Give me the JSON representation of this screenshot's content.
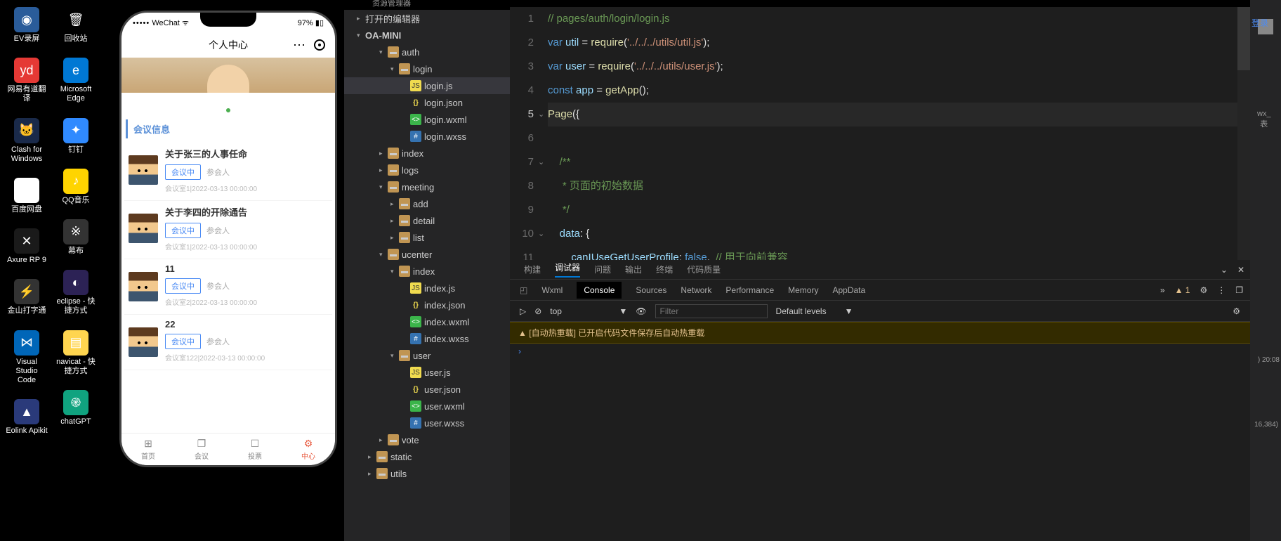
{
  "desktop": {
    "col1": [
      {
        "name": "ev-recorder",
        "label": "EV录屏",
        "bg": "#2a5c9a",
        "glyph": "◉"
      },
      {
        "name": "youdao",
        "label": "网易有道翻译",
        "bg": "#e53935",
        "glyph": "yd"
      },
      {
        "name": "clash",
        "label": "Clash for Windows",
        "bg": "#1a2a4a",
        "glyph": "🐱"
      },
      {
        "name": "baidu-pan",
        "label": "百度网盘",
        "bg": "#fff",
        "glyph": "☁"
      },
      {
        "name": "axure",
        "label": "Axure RP 9",
        "bg": "#1a1a1a",
        "glyph": "✕"
      },
      {
        "name": "jinshan",
        "label": "金山打字通",
        "bg": "#333",
        "glyph": "⚡"
      },
      {
        "name": "vscode",
        "label": "Visual Studio Code",
        "bg": "#0066b8",
        "glyph": "⋈"
      },
      {
        "name": "eolink",
        "label": "Eolink Apikit",
        "bg": "#2a3a7a",
        "glyph": "▲"
      }
    ],
    "col2": [
      {
        "name": "recycle",
        "label": "回收站",
        "bg": "transparent",
        "glyph": "🗑"
      },
      {
        "name": "edge",
        "label": "Microsoft Edge",
        "bg": "#0078d4",
        "glyph": "e"
      },
      {
        "name": "dingtalk",
        "label": "钉钉",
        "bg": "#308aff",
        "glyph": "✦"
      },
      {
        "name": "qqmusic",
        "label": "QQ音乐",
        "bg": "#ffd400",
        "glyph": "♪"
      },
      {
        "name": "mubu",
        "label": "幕布",
        "bg": "#333",
        "glyph": "※"
      },
      {
        "name": "eclipse",
        "label": "eclipse - 快捷方式",
        "bg": "#2c2255",
        "glyph": "◐"
      },
      {
        "name": "navicat",
        "label": "navicat - 快捷方式",
        "bg": "#ffd54f",
        "glyph": "▤"
      },
      {
        "name": "chatgpt",
        "label": "chatGPT",
        "bg": "#10a37f",
        "glyph": "֎"
      }
    ]
  },
  "phone": {
    "carrier": "WeChat",
    "signal": "•••••",
    "batt": "97%",
    "navTitle": "个人中心",
    "sectionTitle": "会议信息",
    "meetings": [
      {
        "title": "关于张三的人事任命",
        "badge": "会议中",
        "part": "参会人",
        "meta": "会议室1|2022-03-13 00:00:00"
      },
      {
        "title": "关于李四的开除通告",
        "badge": "会议中",
        "part": "参会人",
        "meta": "会议室1|2022-03-13 00:00:00"
      },
      {
        "title": "11",
        "badge": "会议中",
        "part": "参会人",
        "meta": "会议室2|2022-03-13 00:00:00"
      },
      {
        "title": "22",
        "badge": "会议中",
        "part": "参会人",
        "meta": "会议室122|2022-03-13 00:00:00"
      }
    ],
    "tabs": [
      {
        "label": "首页",
        "icon": "⊞"
      },
      {
        "label": "会议",
        "icon": "❐"
      },
      {
        "label": "投票",
        "icon": "☐"
      },
      {
        "label": "中心",
        "icon": "⚙"
      }
    ],
    "activeTab": 3
  },
  "ide": {
    "resourceLabel": "资源管理器",
    "tree": [
      {
        "d": 1,
        "chev": "▸",
        "ico": "",
        "label": "打开的编辑器"
      },
      {
        "d": 1,
        "chev": "▾",
        "ico": "",
        "label": "OA-MINI",
        "bold": true
      },
      {
        "d": 3,
        "chev": "▾",
        "ico": "folder",
        "label": "auth"
      },
      {
        "d": 4,
        "chev": "▾",
        "ico": "folder",
        "label": "login"
      },
      {
        "d": 5,
        "chev": "",
        "ico": "js",
        "label": "login.js",
        "sel": true
      },
      {
        "d": 5,
        "chev": "",
        "ico": "json",
        "label": "login.json"
      },
      {
        "d": 5,
        "chev": "",
        "ico": "wxml",
        "label": "login.wxml"
      },
      {
        "d": 5,
        "chev": "",
        "ico": "wxss",
        "label": "login.wxss"
      },
      {
        "d": 3,
        "chev": "▸",
        "ico": "folder",
        "label": "index"
      },
      {
        "d": 3,
        "chev": "▸",
        "ico": "folder",
        "label": "logs"
      },
      {
        "d": 3,
        "chev": "▾",
        "ico": "folder",
        "label": "meeting"
      },
      {
        "d": 4,
        "chev": "▸",
        "ico": "folder",
        "label": "add"
      },
      {
        "d": 4,
        "chev": "▸",
        "ico": "folder",
        "label": "detail"
      },
      {
        "d": 4,
        "chev": "▸",
        "ico": "folder",
        "label": "list"
      },
      {
        "d": 3,
        "chev": "▾",
        "ico": "folder",
        "label": "ucenter"
      },
      {
        "d": 4,
        "chev": "▾",
        "ico": "folder",
        "label": "index"
      },
      {
        "d": 5,
        "chev": "",
        "ico": "js",
        "label": "index.js"
      },
      {
        "d": 5,
        "chev": "",
        "ico": "json",
        "label": "index.json"
      },
      {
        "d": 5,
        "chev": "",
        "ico": "wxml",
        "label": "index.wxml"
      },
      {
        "d": 5,
        "chev": "",
        "ico": "wxss",
        "label": "index.wxss"
      },
      {
        "d": 4,
        "chev": "▾",
        "ico": "folder",
        "label": "user"
      },
      {
        "d": 5,
        "chev": "",
        "ico": "js",
        "label": "user.js"
      },
      {
        "d": 5,
        "chev": "",
        "ico": "json",
        "label": "user.json"
      },
      {
        "d": 5,
        "chev": "",
        "ico": "wxml",
        "label": "user.wxml"
      },
      {
        "d": 5,
        "chev": "",
        "ico": "wxss",
        "label": "user.wxss"
      },
      {
        "d": 3,
        "chev": "▸",
        "ico": "folder",
        "label": "vote"
      },
      {
        "d": 2,
        "chev": "▸",
        "ico": "folder",
        "label": "static",
        "yellow": true
      },
      {
        "d": 2,
        "chev": "▸",
        "ico": "folder",
        "label": "utils"
      }
    ]
  },
  "editor": {
    "lines": [
      {
        "n": 1,
        "html": "<span class='c-cmt'>// pages/auth/login/login.js</span>"
      },
      {
        "n": 2,
        "html": "<span class='c-kw'>var</span> <span class='c-var'>util</span> <span class='c-op'>=</span> <span class='c-fn'>require</span><span class='c-pun'>(</span><span class='c-str'>'../../../utils/util.js'</span><span class='c-pun'>);</span>"
      },
      {
        "n": 3,
        "html": "<span class='c-kw'>var</span> <span class='c-var'>user</span> <span class='c-op'>=</span> <span class='c-fn'>require</span><span class='c-pun'>(</span><span class='c-str'>'../../../utils/user.js'</span><span class='c-pun'>);</span>"
      },
      {
        "n": 4,
        "html": "<span class='c-kw'>const</span> <span class='c-var'>app</span> <span class='c-op'>=</span> <span class='c-fn'>getApp</span><span class='c-pun'>();</span>"
      },
      {
        "n": 5,
        "html": "<span class='c-fn'>Page</span><span class='c-pun'>({</span>",
        "cur": true
      },
      {
        "n": 6,
        "html": ""
      },
      {
        "n": 7,
        "html": "    <span class='c-doc'>/**</span>"
      },
      {
        "n": 8,
        "html": "<span class='c-doc'>     * 页面的初始数据</span>"
      },
      {
        "n": 9,
        "html": "<span class='c-doc'>     */</span>"
      },
      {
        "n": 10,
        "html": "    <span class='c-var'>data</span><span class='c-pun'>: {</span>"
      },
      {
        "n": 11,
        "html": "        <span class='c-var'>canIUseGetUserProfile</span><span class='c-pun'>:</span> <span class='c-bool'>false</span><span class='c-pun'>,</span>  <span class='c-cmt'>// 用于向前兼容</span>"
      }
    ]
  },
  "dbg": {
    "tabs1": [
      "构建",
      "调试器",
      "问题",
      "输出",
      "终端",
      "代码质量"
    ],
    "tabs1Active": 1,
    "tabs2": [
      "Wxml",
      "Console",
      "Sources",
      "Network",
      "Performance",
      "Memory",
      "AppData"
    ],
    "tabs2Active": 1,
    "warnCount": "1",
    "context": "top",
    "filterPlaceholder": "Filter",
    "levels": "Default levels",
    "consoleMsg": "[自动热重载] 已开启代码文件保存后自动热重载",
    "moreIcon": "»"
  },
  "rside": {
    "login": "登录",
    "wx": "wx_",
    "table": "表",
    "coords": "16,384)",
    "time": ") 20:08"
  }
}
